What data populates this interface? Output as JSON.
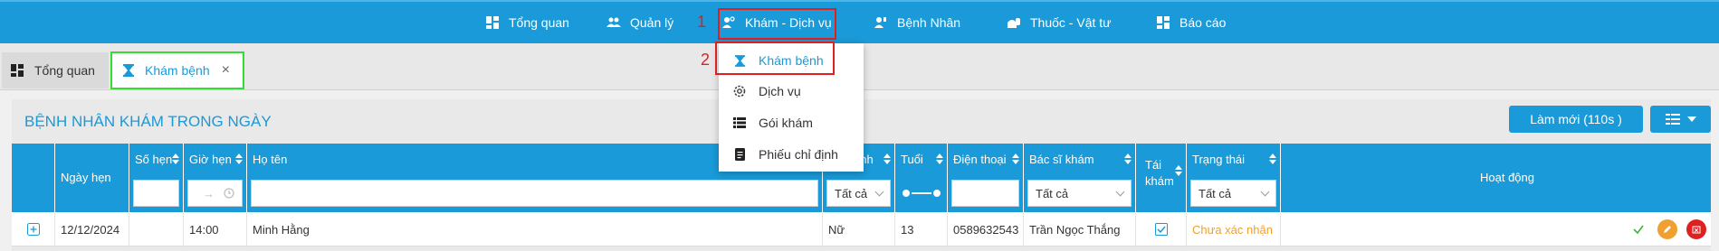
{
  "nav": {
    "items": [
      {
        "label": "Tổng quan",
        "icon": "dashboard-icon"
      },
      {
        "label": "Quản lý",
        "icon": "users-icon"
      },
      {
        "label": "Khám - Dịch vụ",
        "icon": "doctor-icon"
      },
      {
        "label": "Bệnh Nhân",
        "icon": "patient-icon"
      },
      {
        "label": "Thuốc - Vật tư",
        "icon": "medicine-icon"
      },
      {
        "label": "Báo cáo",
        "icon": "report-icon"
      }
    ],
    "annotation_1": "1",
    "annotation_2": "2"
  },
  "dropdown": {
    "items": [
      {
        "label": "Khám bệnh",
        "icon": "hourglass-icon"
      },
      {
        "label": "Dịch vụ",
        "icon": "gear-icon"
      },
      {
        "label": "Gói khám",
        "icon": "list-icon"
      },
      {
        "label": "Phiếu chỉ định",
        "icon": "document-icon"
      }
    ]
  },
  "tabs": [
    {
      "label": "Tổng quan",
      "icon": "dashboard-icon"
    },
    {
      "label": "Khám bệnh",
      "icon": "hourglass-icon",
      "close": "×"
    }
  ],
  "panel": {
    "title": "BỆNH NHÂN KHÁM TRONG NGÀY",
    "refresh_label": "Làm mới (110s )"
  },
  "table": {
    "columns": {
      "ngay_hen": "Ngày hẹn",
      "so_hen": "Số hẹn",
      "gio_hen": "Giờ hẹn",
      "ho_ten": "Họ tên",
      "gioi_tinh": "Giới tính",
      "tuoi": "Tuổi",
      "dien_thoai": "Điện thoại",
      "bac_si": "Bác sĩ khám",
      "tai_kham_1": "Tái",
      "tai_kham_2": "khám",
      "trang_thai": "Trạng thái",
      "hoat_dong": "Hoạt động"
    },
    "filters": {
      "gioi_tinh": "Tất cả",
      "bac_si": "Tất cả",
      "trang_thai": "Tất cả",
      "time_arrow": "→"
    },
    "rows": [
      {
        "ngay_hen": "12/12/2024",
        "so_hen": "",
        "gio_hen": "14:00",
        "ho_ten": "Minh Hằng",
        "gioi_tinh": "Nữ",
        "tuoi": "13",
        "dien_thoai": "0589632543",
        "bac_si": "Trần Ngọc Thắng",
        "tai_kham": true,
        "trang_thai": "Chưa xác nhận"
      }
    ]
  },
  "colors": {
    "primary": "#1a9ad8",
    "highlight_red": "#e02020",
    "highlight_green": "#33dd33",
    "status_orange": "#f0a030"
  }
}
